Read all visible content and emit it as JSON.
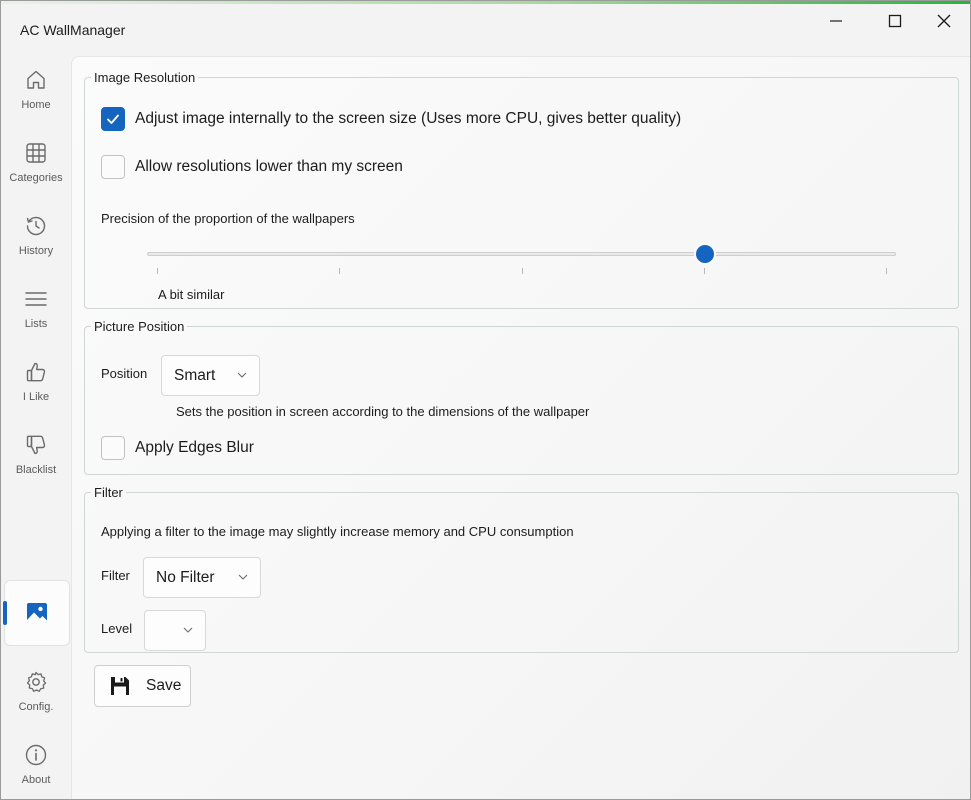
{
  "app": {
    "title": "AC WallManager"
  },
  "window_controls": {
    "minimize": "minimize-icon",
    "maximize": "maximize-icon",
    "close": "close-icon"
  },
  "sidebar": {
    "items": [
      {
        "label": "Home",
        "icon": "home-icon"
      },
      {
        "label": "Categories",
        "icon": "grid-icon"
      },
      {
        "label": "History",
        "icon": "history-icon"
      },
      {
        "label": "Lists",
        "icon": "list-icon"
      },
      {
        "label": "I Like",
        "icon": "thumbs-up-icon"
      },
      {
        "label": "Blacklist",
        "icon": "thumbs-down-icon"
      }
    ],
    "active_item": {
      "icon": "image-icon"
    },
    "bottom_items": [
      {
        "label": "Config.",
        "icon": "gear-icon"
      },
      {
        "label": "About",
        "icon": "info-icon"
      }
    ]
  },
  "image_resolution": {
    "legend": "Image Resolution",
    "adjust_label": "Adjust image internally to the screen size (Uses more CPU, gives better quality)",
    "adjust_checked": true,
    "lower_label": "Allow resolutions lower than my screen",
    "lower_checked": false,
    "precision_label": "Precision of the proportion of the wallpapers",
    "slider": {
      "value": 3,
      "min": 0,
      "max": 4,
      "value_label": "A bit similar"
    }
  },
  "picture_position": {
    "legend": "Picture Position",
    "position_label": "Position",
    "position_value": "Smart",
    "description": "Sets the position in screen according to the dimensions of the wallpaper",
    "blur_label": "Apply Edges Blur",
    "blur_checked": false
  },
  "filter": {
    "legend": "Filter",
    "description": "Applying a filter to the image may slightly increase memory and CPU consumption",
    "filter_label": "Filter",
    "filter_value": "No Filter",
    "level_label": "Level",
    "level_value": ""
  },
  "save_button": {
    "label": "Save",
    "icon": "save-icon"
  },
  "colors": {
    "accent": "#1565c0",
    "title_gradient_end": "#27b43a"
  }
}
